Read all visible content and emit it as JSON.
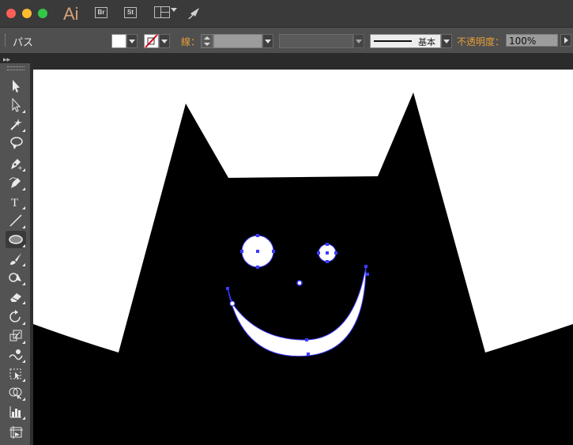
{
  "app": {
    "logo_text": "Ai",
    "bridge_label": "Br",
    "stock_label": "St"
  },
  "control_bar": {
    "selection_type": "パス",
    "stroke_label": "線：",
    "stroke_style_label": "基本",
    "opacity_label": "不透明度：",
    "opacity_value": "100%"
  },
  "colors": {
    "fill": "#ffffff",
    "stroke": "none",
    "anchor_selection": "#3a3aff",
    "accent_label": "#e79e37"
  },
  "toolbar": {
    "tools": [
      {
        "name": "selection-tool",
        "icon": "arrow-icon"
      },
      {
        "name": "direct-selection-tool",
        "icon": "white-arrow-icon"
      },
      {
        "name": "magic-wand-tool",
        "icon": "magic-wand-icon"
      },
      {
        "name": "lasso-tool",
        "icon": "lasso-icon"
      },
      {
        "name": "pen-tool",
        "icon": "pen-icon"
      },
      {
        "name": "curvature-tool",
        "icon": "curvature-pen-icon"
      },
      {
        "name": "type-tool",
        "icon": "type-icon",
        "glyph": "T"
      },
      {
        "name": "line-segment-tool",
        "icon": "line-icon"
      },
      {
        "name": "ellipse-tool",
        "icon": "ellipse-icon",
        "selected": true
      },
      {
        "name": "paintbrush-tool",
        "icon": "brush-icon"
      },
      {
        "name": "shaper-tool",
        "icon": "shaper-icon"
      },
      {
        "name": "eraser-tool",
        "icon": "eraser-icon"
      },
      {
        "name": "rotate-tool",
        "icon": "rotate-icon"
      },
      {
        "name": "scale-tool",
        "icon": "scale-icon"
      },
      {
        "name": "warp-tool",
        "icon": "warp-icon"
      },
      {
        "name": "free-transform-tool",
        "icon": "free-transform-icon"
      },
      {
        "name": "shape-builder-tool",
        "icon": "shape-builder-icon"
      },
      {
        "name": "graph-tool",
        "icon": "graph-icon"
      },
      {
        "name": "artboard-tool",
        "icon": "artboard-icon"
      }
    ]
  }
}
